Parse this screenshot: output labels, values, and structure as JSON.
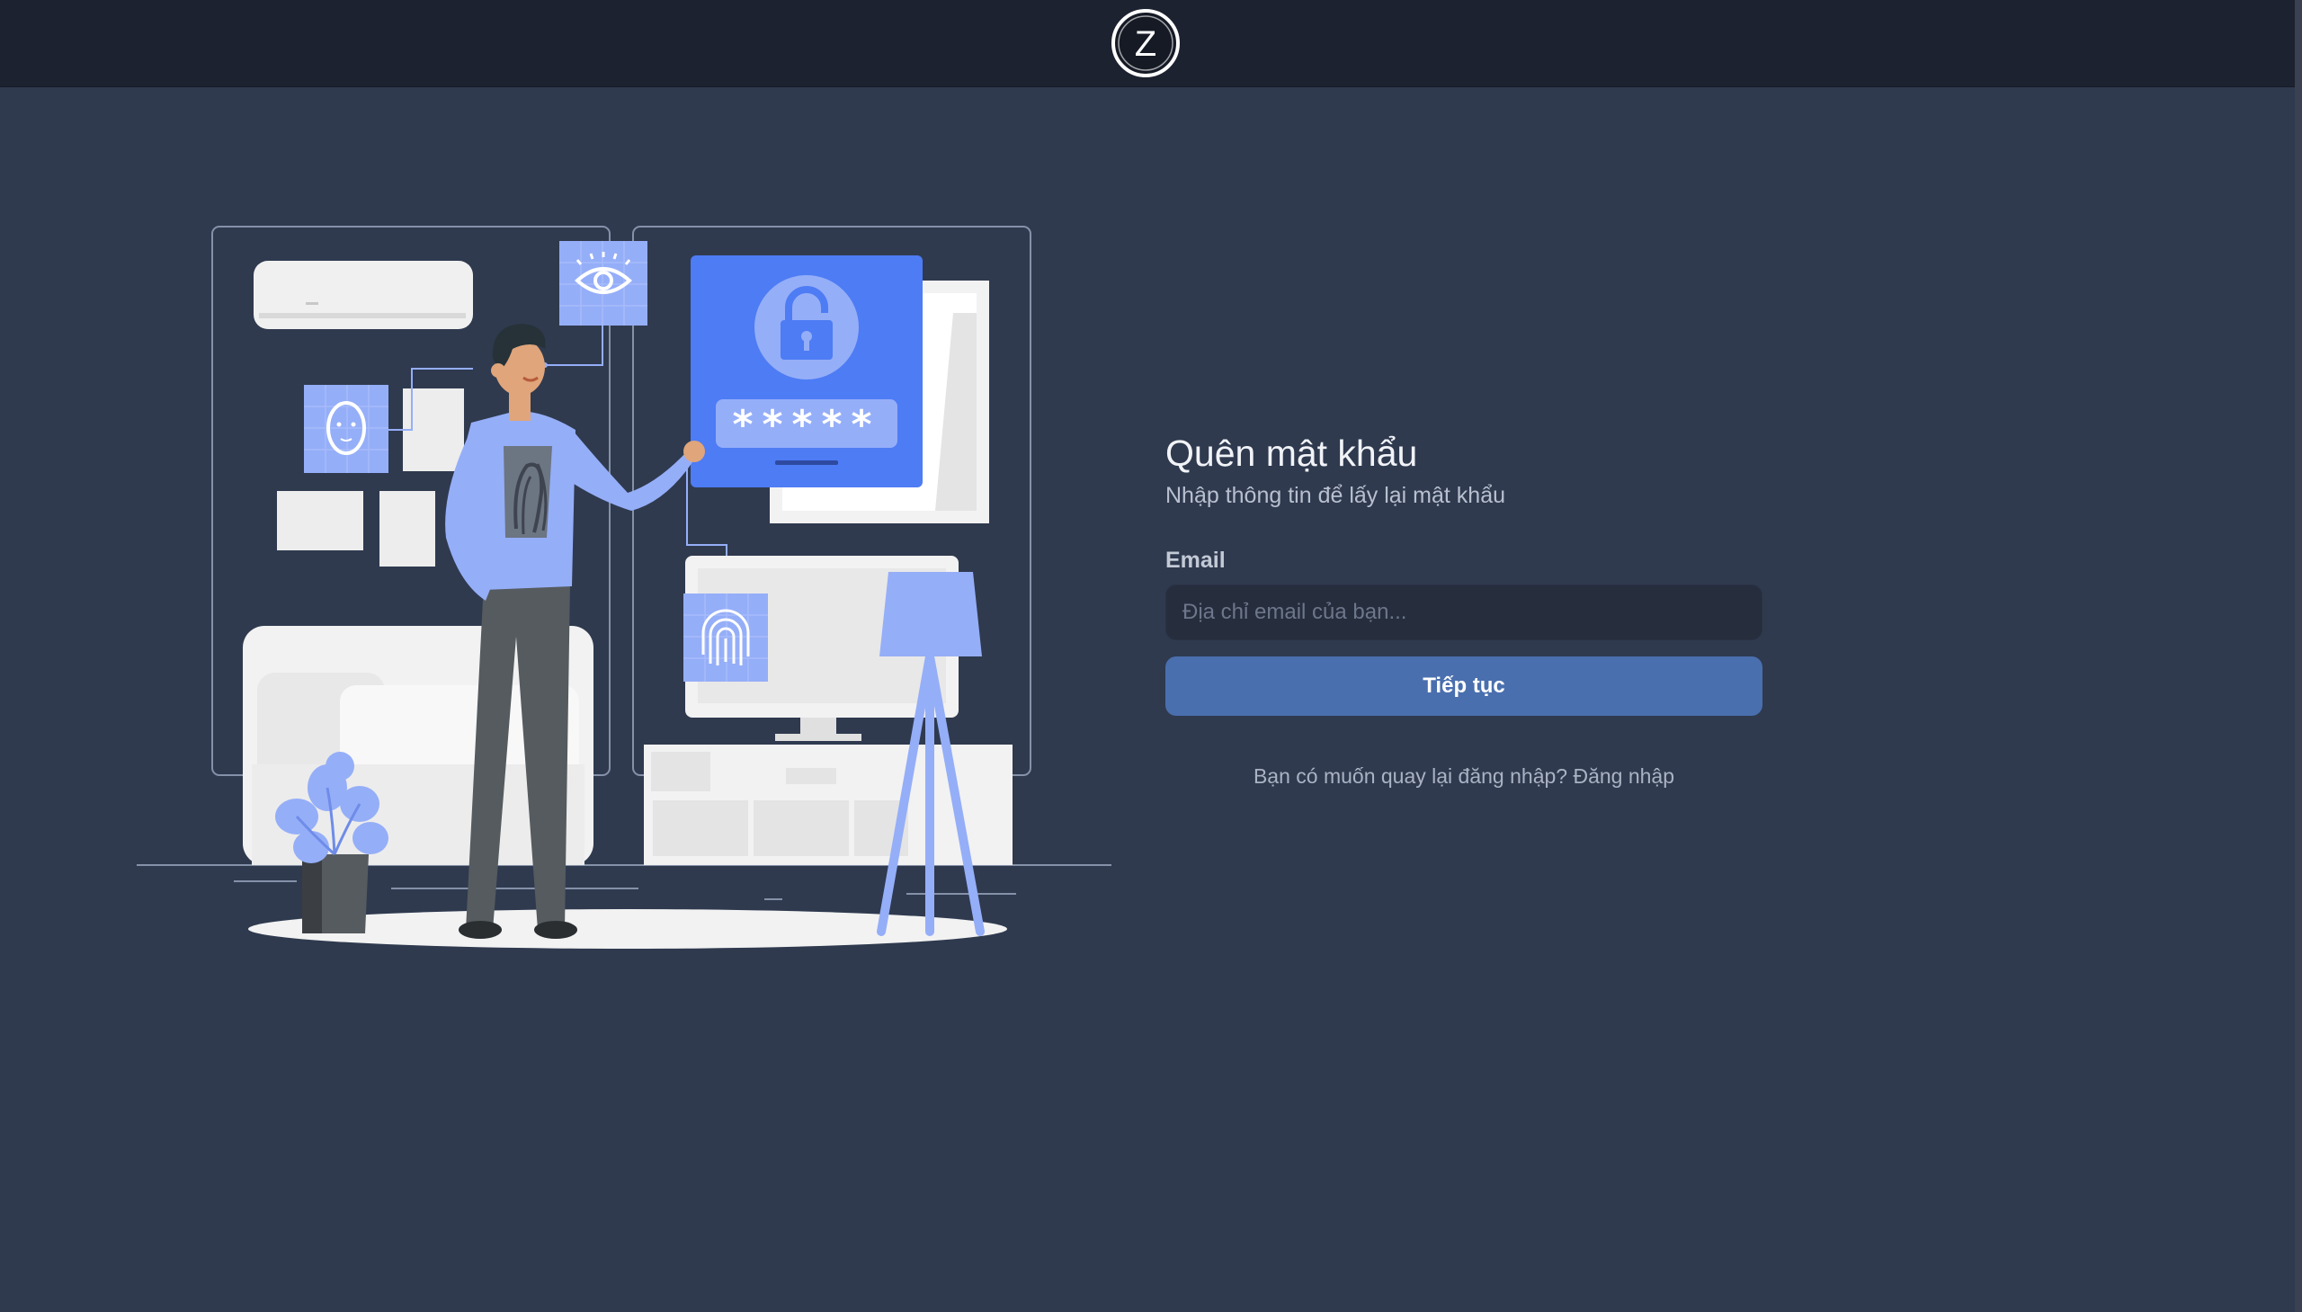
{
  "header": {
    "logo_letter": "Z",
    "logo_icon": "z-logo-icon"
  },
  "illustration": {
    "password_mask": "*****",
    "icons": [
      "eye-icon",
      "face-icon",
      "padlock-icon",
      "fingerprint-icon"
    ],
    "accent_color": "#4d7cf4",
    "light_accent_color": "#95aef8"
  },
  "form": {
    "title": "Quên mật khẩu",
    "subtitle": "Nhập thông tin để lấy lại mật khẩu",
    "email_label": "Email",
    "email_placeholder": "Địa chỉ email của bạn...",
    "email_value": "",
    "submit_label": "Tiếp tục",
    "back_prompt": "Bạn có muốn quay lại đăng nhập?",
    "back_link": "Đăng nhập"
  },
  "colors": {
    "background": "#2f3a4f",
    "topbar": "#1d2230",
    "button": "#4a6fae",
    "input_bg": "#262d3d"
  }
}
